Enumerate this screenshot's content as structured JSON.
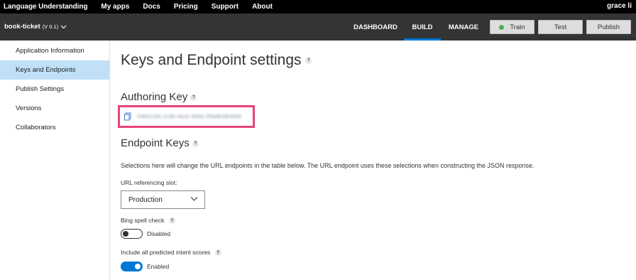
{
  "topnav": {
    "brand": "Language Understanding",
    "links": [
      "My apps",
      "Docs",
      "Pricing",
      "Support",
      "About"
    ],
    "user": "grace li"
  },
  "appbar": {
    "app_name": "book-ticket",
    "version": "(V 0.1)",
    "tabs": [
      "DASHBOARD",
      "BUILD",
      "MANAGE"
    ],
    "active_tab": "BUILD",
    "train_label": "Train",
    "test_label": "Test",
    "publish_label": "Publish"
  },
  "sidebar": {
    "items": [
      {
        "label": "Application Information"
      },
      {
        "label": "Keys and Endpoints"
      },
      {
        "label": "Publish Settings"
      },
      {
        "label": "Versions"
      },
      {
        "label": "Collaborators"
      }
    ],
    "active": "Keys and Endpoints"
  },
  "main": {
    "title": "Keys and Endpoint settings",
    "authoring_heading": "Authoring Key",
    "authoring_key": "7e8d1c9a-1c4b-4a1e-9e6a-2f6a8c5b4d3e",
    "endpoint_heading": "Endpoint Keys",
    "description": "Selections here will change the URL endpoints in the table below. The URL endpoint uses these selections when constructing the JSON response.",
    "slot_label": "URL referencing slot:",
    "slot_value": "Production",
    "bing_label": "Bing spell check",
    "bing_state": "Disabled",
    "intent_label": "Include all predicted intent scores",
    "intent_state": "Enabled",
    "help_glyph": "?"
  },
  "colors": {
    "accent": "#0078d4",
    "highlight_border": "#e8447a",
    "sidebar_active": "#bfe0f7",
    "train_dot": "#4caf50"
  }
}
